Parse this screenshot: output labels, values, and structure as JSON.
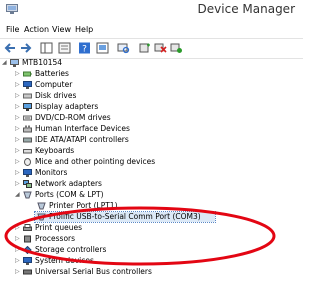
{
  "window": {
    "title": "Device Manager"
  },
  "menu": [
    "File",
    "Action",
    "View",
    "Help"
  ],
  "toolbar": [
    "back-icon",
    "forward-icon",
    "show-hide-tree-icon",
    "properties-icon",
    "help-icon",
    "update-driver-icon",
    "scan-hardware-icon",
    "add-legacy-icon",
    "disable-device-icon",
    "uninstall-device-icon"
  ],
  "tree": [
    {
      "label": "MTB10154",
      "icon": "computer-icon"
    },
    {
      "label": "Batteries",
      "icon": "battery-icon"
    },
    {
      "label": "Computer",
      "icon": "computer-icon"
    },
    {
      "label": "Disk drives",
      "icon": "disk-icon"
    },
    {
      "label": "Display adapters",
      "icon": "monitor-icon"
    },
    {
      "label": "DVD/CD-ROM drives",
      "icon": "dvd-icon"
    },
    {
      "label": "Human Interface Devices",
      "icon": "hid-icon"
    },
    {
      "label": "IDE ATA/ATAPI controllers",
      "icon": "ide-icon"
    },
    {
      "label": "Keyboards",
      "icon": "keyboard-icon"
    },
    {
      "label": "Mice and other pointing devices",
      "icon": "mouse-icon"
    },
    {
      "label": "Monitors",
      "icon": "monitor-icon"
    },
    {
      "label": "Network adapters",
      "icon": "network-icon"
    },
    {
      "label": "Ports (COM & LPT)",
      "icon": "port-icon"
    },
    {
      "label": "Printer Port (LPT1)",
      "icon": "port-icon"
    },
    {
      "label": "Prolific USB-to-Serial Comm Port (COM3)",
      "icon": "port-icon"
    },
    {
      "label": "Print queues",
      "icon": "printer-icon"
    },
    {
      "label": "Processors",
      "icon": "cpu-icon"
    },
    {
      "label": "Storage controllers",
      "icon": "storage-icon"
    },
    {
      "label": "System devices",
      "icon": "system-icon"
    },
    {
      "label": "Universal Serial Bus controllers",
      "icon": "usb-icon"
    }
  ],
  "annotation": {
    "color": "#e30613"
  }
}
